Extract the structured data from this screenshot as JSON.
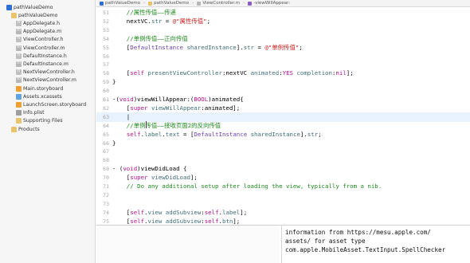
{
  "navigator": {
    "items": [
      {
        "label": "pathValueDemo",
        "icon": "project-icon",
        "disclosure": "▾"
      },
      {
        "label": "pathValueDemo",
        "icon": "folder-icon",
        "disclosure": "▾"
      },
      {
        "label": "AppDelegate.h",
        "icon": "header-file-icon",
        "disclosure": ""
      },
      {
        "label": "AppDelegate.m",
        "icon": "implementation-file-icon",
        "disclosure": ""
      },
      {
        "label": "ViewController.h",
        "icon": "header-file-icon",
        "disclosure": ""
      },
      {
        "label": "ViewController.m",
        "icon": "implementation-file-icon",
        "disclosure": ""
      },
      {
        "label": "DefaultInstance.h",
        "icon": "header-file-icon",
        "disclosure": ""
      },
      {
        "label": "DefaultInstance.m",
        "icon": "implementation-file-icon",
        "disclosure": ""
      },
      {
        "label": "NextViewController.h",
        "icon": "header-file-icon",
        "disclosure": ""
      },
      {
        "label": "NextViewController.m",
        "icon": "implementation-file-icon",
        "disclosure": ""
      },
      {
        "label": "Main.storyboard",
        "icon": "storyboard-icon",
        "disclosure": ""
      },
      {
        "label": "Assets.xcassets",
        "icon": "assets-icon",
        "disclosure": ""
      },
      {
        "label": "LaunchScreen.storyboard",
        "icon": "storyboard-icon",
        "disclosure": ""
      },
      {
        "label": "Info.plist",
        "icon": "plist-icon",
        "disclosure": ""
      },
      {
        "label": "Supporting Files",
        "icon": "folder-icon",
        "disclosure": "▸"
      },
      {
        "label": "Products",
        "icon": "folder-icon",
        "disclosure": "▸"
      }
    ]
  },
  "jumpbar": {
    "crumbs": [
      "pathValueDemo",
      "pathValueDemo",
      "ViewController.m",
      "-viewWillAppear:"
    ]
  },
  "editor": {
    "lines": [
      {
        "num": "51",
        "tokens": [
          {
            "t": "    //属性传值——传递",
            "c": "comment"
          }
        ]
      },
      {
        "num": "52",
        "tokens": [
          {
            "t": "    nextVC.",
            "c": "plain"
          },
          {
            "t": "str",
            "c": "method"
          },
          {
            "t": " = ",
            "c": "plain"
          },
          {
            "t": "@\"属性传值\"",
            "c": "string"
          },
          {
            "t": ";",
            "c": "plain"
          }
        ]
      },
      {
        "num": "53",
        "tokens": []
      },
      {
        "num": "54",
        "tokens": [
          {
            "t": "    //单例传值——正向传值",
            "c": "comment"
          }
        ]
      },
      {
        "num": "55",
        "tokens": [
          {
            "t": "    [",
            "c": "plain"
          },
          {
            "t": "DefaultInstance",
            "c": "type"
          },
          {
            "t": " ",
            "c": "plain"
          },
          {
            "t": "sharedInstance",
            "c": "method"
          },
          {
            "t": "].",
            "c": "plain"
          },
          {
            "t": "str",
            "c": "method"
          },
          {
            "t": " = ",
            "c": "plain"
          },
          {
            "t": "@\"单例传值\"",
            "c": "string"
          },
          {
            "t": ";",
            "c": "plain"
          }
        ]
      },
      {
        "num": "56",
        "tokens": []
      },
      {
        "num": "57",
        "tokens": []
      },
      {
        "num": "58",
        "tokens": [
          {
            "t": "    [",
            "c": "plain"
          },
          {
            "t": "self",
            "c": "keyword"
          },
          {
            "t": " ",
            "c": "plain"
          },
          {
            "t": "presentViewController",
            "c": "method"
          },
          {
            "t": ":nextVC ",
            "c": "plain"
          },
          {
            "t": "animated",
            "c": "method"
          },
          {
            "t": ":",
            "c": "plain"
          },
          {
            "t": "YES",
            "c": "keyword"
          },
          {
            "t": " ",
            "c": "plain"
          },
          {
            "t": "completion",
            "c": "method"
          },
          {
            "t": ":",
            "c": "plain"
          },
          {
            "t": "nil",
            "c": "keyword"
          },
          {
            "t": "];",
            "c": "plain"
          }
        ]
      },
      {
        "num": "59",
        "tokens": [
          {
            "t": "}",
            "c": "plain"
          }
        ]
      },
      {
        "num": "60",
        "tokens": []
      },
      {
        "num": "61",
        "tokens": [
          {
            "t": "-(",
            "c": "plain"
          },
          {
            "t": "void",
            "c": "keyword"
          },
          {
            "t": ")viewWillAppear:(",
            "c": "plain"
          },
          {
            "t": "BOOL",
            "c": "keyword"
          },
          {
            "t": ")animated{",
            "c": "plain"
          }
        ]
      },
      {
        "num": "62",
        "tokens": [
          {
            "t": "    [",
            "c": "plain"
          },
          {
            "t": "super",
            "c": "keyword"
          },
          {
            "t": " ",
            "c": "plain"
          },
          {
            "t": "viewWillAppear",
            "c": "method"
          },
          {
            "t": ":animated];",
            "c": "plain"
          }
        ]
      },
      {
        "num": "63",
        "tokens": [
          {
            "t": "    |",
            "c": "plain"
          }
        ],
        "current": true
      },
      {
        "num": "64",
        "tokens": [
          {
            "t": "    //单例传值——接收页面2的反向传值",
            "c": "comment"
          }
        ]
      },
      {
        "num": "65",
        "tokens": [
          {
            "t": "    ",
            "c": "plain"
          },
          {
            "t": "self",
            "c": "keyword"
          },
          {
            "t": ".",
            "c": "plain"
          },
          {
            "t": "label",
            "c": "method"
          },
          {
            "t": ".",
            "c": "plain"
          },
          {
            "t": "text",
            "c": "method"
          },
          {
            "t": " = [",
            "c": "plain"
          },
          {
            "t": "DefaultInstance",
            "c": "type"
          },
          {
            "t": " ",
            "c": "plain"
          },
          {
            "t": "sharedInstance",
            "c": "method"
          },
          {
            "t": "].",
            "c": "plain"
          },
          {
            "t": "str",
            "c": "method"
          },
          {
            "t": ";",
            "c": "plain"
          }
        ]
      },
      {
        "num": "66",
        "tokens": [
          {
            "t": "}",
            "c": "plain"
          }
        ]
      },
      {
        "num": "67",
        "tokens": []
      },
      {
        "num": "68",
        "tokens": []
      },
      {
        "num": "69",
        "tokens": [
          {
            "t": "- (",
            "c": "plain"
          },
          {
            "t": "void",
            "c": "keyword"
          },
          {
            "t": ")viewDidLoad {",
            "c": "plain"
          }
        ]
      },
      {
        "num": "70",
        "tokens": [
          {
            "t": "    [",
            "c": "plain"
          },
          {
            "t": "super",
            "c": "keyword"
          },
          {
            "t": " ",
            "c": "plain"
          },
          {
            "t": "viewDidLoad",
            "c": "method"
          },
          {
            "t": "];",
            "c": "plain"
          }
        ]
      },
      {
        "num": "71",
        "tokens": [
          {
            "t": "    // Do any additional setup after loading the view, typically from a nib.",
            "c": "comment"
          }
        ]
      },
      {
        "num": "72",
        "tokens": []
      },
      {
        "num": "73",
        "tokens": []
      },
      {
        "num": "74",
        "tokens": [
          {
            "t": "    [",
            "c": "plain"
          },
          {
            "t": "self",
            "c": "keyword"
          },
          {
            "t": ".",
            "c": "plain"
          },
          {
            "t": "view",
            "c": "method"
          },
          {
            "t": " ",
            "c": "plain"
          },
          {
            "t": "addSubview",
            "c": "method"
          },
          {
            "t": ":",
            "c": "plain"
          },
          {
            "t": "self",
            "c": "keyword"
          },
          {
            "t": ".",
            "c": "plain"
          },
          {
            "t": "label",
            "c": "method"
          },
          {
            "t": "];",
            "c": "plain"
          }
        ]
      },
      {
        "num": "75",
        "tokens": [
          {
            "t": "    [",
            "c": "plain"
          },
          {
            "t": "self",
            "c": "keyword"
          },
          {
            "t": ".",
            "c": "plain"
          },
          {
            "t": "view",
            "c": "method"
          },
          {
            "t": " ",
            "c": "plain"
          },
          {
            "t": "addSubview",
            "c": "method"
          },
          {
            "t": ":",
            "c": "plain"
          },
          {
            "t": "self",
            "c": "keyword"
          },
          {
            "t": ".",
            "c": "plain"
          },
          {
            "t": "btn",
            "c": "method"
          },
          {
            "t": "];",
            "c": "plain"
          }
        ]
      }
    ]
  },
  "console": {
    "lines": [
      "information from https://mesu.apple.com/",
      "assets/ for asset type",
      "com.apple.MobileAsset.TextInput.SpellChecker"
    ]
  },
  "colors": {
    "comment": "#1e8a1e",
    "keyword": "#b10f90",
    "type": "#6b3fae",
    "string": "#c41a16",
    "method": "#3e6d76",
    "current_line": "#e8f2fe"
  }
}
